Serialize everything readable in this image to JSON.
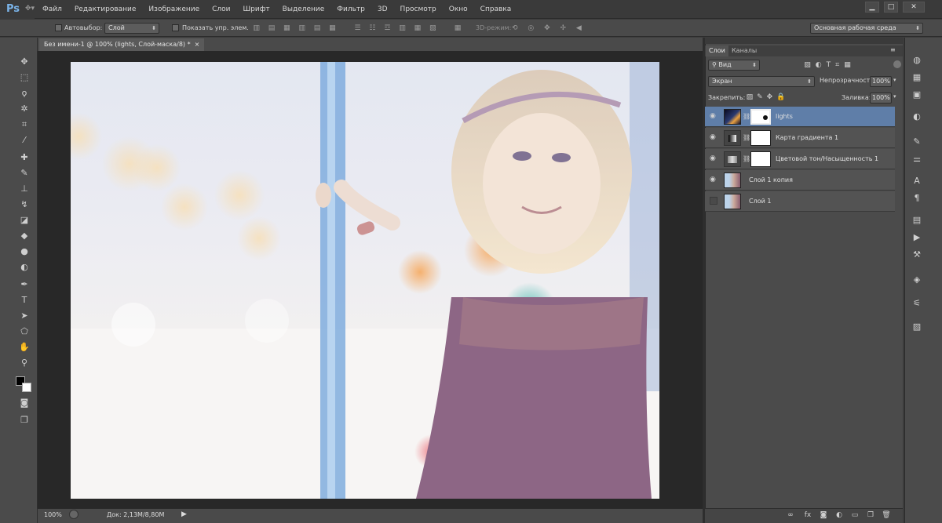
{
  "app": {
    "logo": "Ps"
  },
  "menu": [
    "Файл",
    "Редактирование",
    "Изображение",
    "Слои",
    "Шрифт",
    "Выделение",
    "Фильтр",
    "3D",
    "Просмотр",
    "Окно",
    "Справка"
  ],
  "window_controls": {
    "minimize": "▁",
    "maximize": "□",
    "close": "✕"
  },
  "options_bar": {
    "autoselect_label": "Автовыбор:",
    "autoselect_value": "Слой",
    "show_controls_label": "Показать упр. элем.",
    "mode3d_label": "3D-режим:",
    "workspace": "Основная рабочая среда"
  },
  "document": {
    "tab_title": "Без имени-1 @ 100% (lights, Слой-маска/8) *",
    "tab_close": "×"
  },
  "status": {
    "zoom": "100%",
    "doc_info": "Док: 2,13M/8,80M"
  },
  "layers_panel": {
    "tabs": [
      "Слои",
      "Каналы"
    ],
    "filter_label": "Вид",
    "blend_mode": "Экран",
    "opacity_label": "Непрозрачность:",
    "opacity_value": "100%",
    "lock_label": "Закрепить:",
    "fill_label": "Заливка:",
    "fill_value": "100%",
    "layers": [
      {
        "name": "lights",
        "visible": true,
        "selected": true
      },
      {
        "name": "Карта градиента 1",
        "visible": true,
        "selected": false
      },
      {
        "name": "Цветовой тон/Насыщенность 1",
        "visible": true,
        "selected": false
      },
      {
        "name": "Слой 1 копия",
        "visible": true,
        "selected": false
      },
      {
        "name": "Слой 1",
        "visible": false,
        "selected": false
      }
    ]
  },
  "colors": {
    "accent": "#5f7ea8",
    "ps_blue": "#7ab3e8",
    "panel": "#4b4b4b",
    "canvas_bg": "#282828"
  }
}
